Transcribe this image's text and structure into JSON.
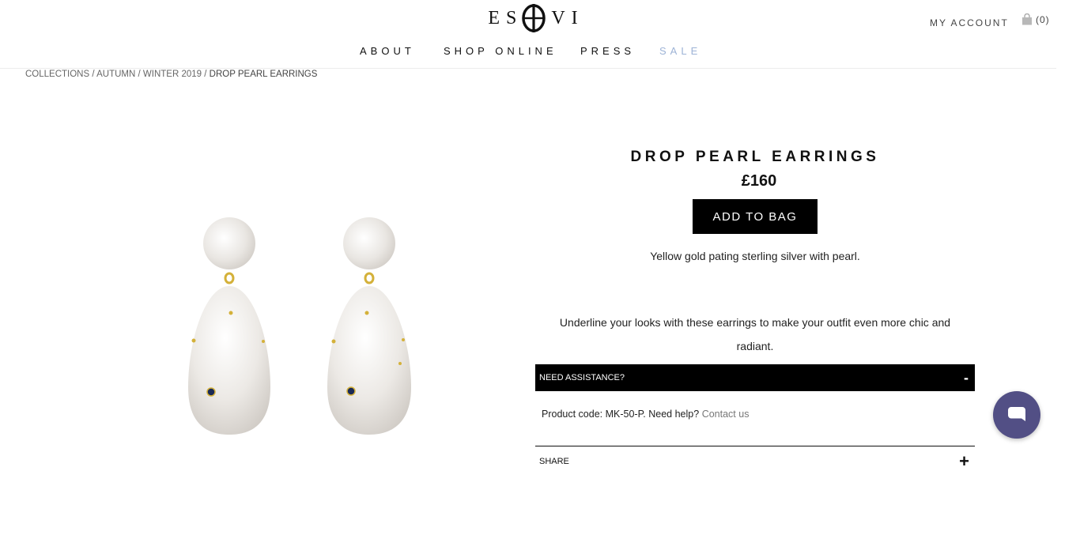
{
  "header": {
    "logo_left": "ES",
    "logo_right": "VI",
    "account_label": "MY ACCOUNT",
    "bag_count": "(0)"
  },
  "nav": {
    "items": [
      {
        "label": "ABOUT"
      },
      {
        "label": "SHOP ONLINE"
      },
      {
        "label": "PRESS"
      },
      {
        "label": "SALE"
      }
    ],
    "sale_color": "#9db3d6"
  },
  "breadcrumb": {
    "items": [
      "COLLECTIONS",
      "AUTUMN",
      "WINTER 2019",
      "DROP PEARL EARRINGS"
    ],
    "separator": " / "
  },
  "product": {
    "title": "DROP PEARL EARRINGS",
    "price": "£160",
    "add_to_bag_label": "ADD TO BAG",
    "short_description": "Yellow gold pating sterling silver with pearl.",
    "long_description": "Underline your looks with these earrings to make your outfit even more chic and radiant.",
    "image_icon": "pearl-earrings-image"
  },
  "accordion": {
    "assistance_label": "NEED ASSISTANCE?",
    "assistance_toggle": "-",
    "product_code_text": "Product code: MK-50-P. Need help?",
    "contact_link": "Contact us",
    "share_label": "SHARE",
    "share_toggle": "+"
  },
  "chat": {
    "icon": "chat-bubble-icon",
    "color": "#524f85"
  }
}
